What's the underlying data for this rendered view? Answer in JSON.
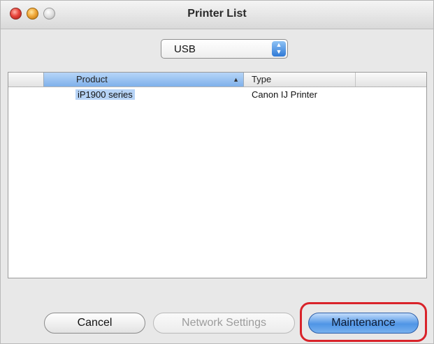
{
  "window": {
    "title": "Printer List"
  },
  "connection_select": {
    "value": "USB"
  },
  "printer_table": {
    "columns": [
      "Product",
      "Type"
    ],
    "rows": [
      {
        "product": "iP1900 series",
        "type": "Canon IJ Printer"
      }
    ]
  },
  "buttons": {
    "cancel": "Cancel",
    "network_settings": "Network Settings",
    "maintenance": "Maintenance"
  },
  "colors": {
    "highlight": "#d9232a",
    "default_button": "#4f95e6",
    "selection": "#b6d3f6"
  }
}
